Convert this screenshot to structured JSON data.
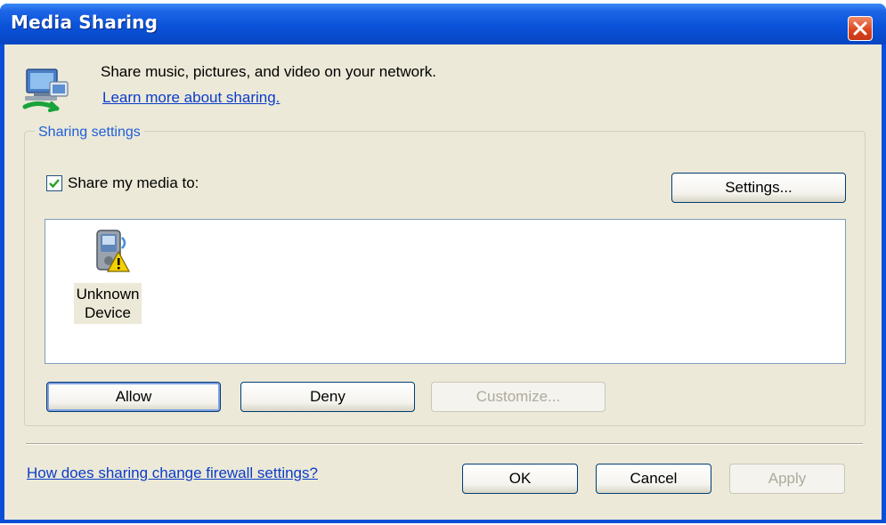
{
  "window": {
    "title": "Media Sharing",
    "colors": {
      "titlebar": "#0a52d9",
      "client_bg": "#ece9d8",
      "link": "#0b3cc9",
      "group_label": "#1f5ed8"
    }
  },
  "header": {
    "icon": "network-sharing-icon",
    "description": "Share music, pictures, and video on your network.",
    "learn_more_link": "Learn more about sharing."
  },
  "sharing_settings": {
    "group_label": "Sharing settings",
    "share_checkbox_label": "Share my media to:",
    "share_checked": true,
    "settings_button": "Settings...",
    "devices": [
      {
        "name_line1": "Unknown",
        "name_line2": "Device",
        "icon": "media-device-warning-icon"
      }
    ],
    "allow_button": "Allow",
    "deny_button": "Deny",
    "customize_button": "Customize..."
  },
  "footer": {
    "firewall_link": "How does sharing change firewall settings?",
    "ok_button": "OK",
    "cancel_button": "Cancel",
    "apply_button": "Apply"
  }
}
